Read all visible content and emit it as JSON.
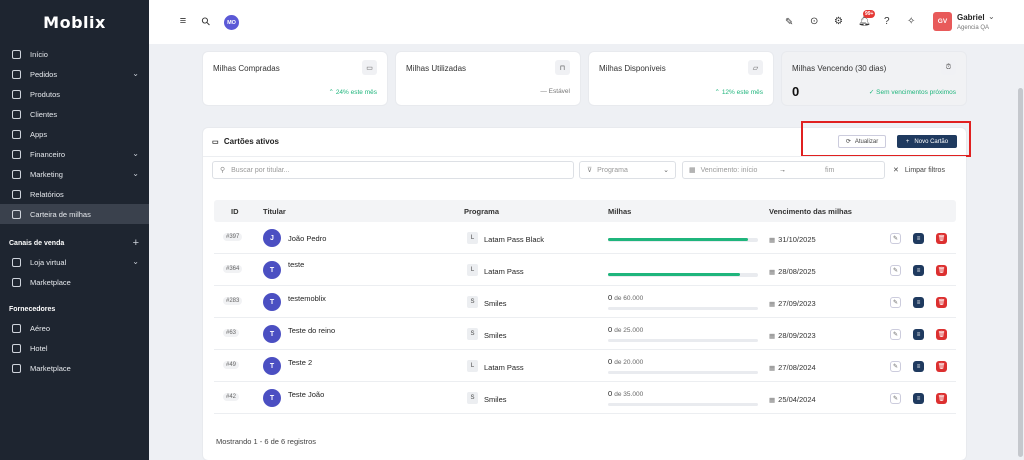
{
  "app": {
    "logo": "Moblix"
  },
  "sidebar": {
    "items": [
      {
        "label": "Início",
        "icon": "home-icon"
      },
      {
        "label": "Pedidos",
        "icon": "document-icon",
        "chevron": true
      },
      {
        "label": "Produtos",
        "icon": "box-icon"
      },
      {
        "label": "Clientes",
        "icon": "users-icon"
      },
      {
        "label": "Apps",
        "icon": "grid-icon"
      },
      {
        "label": "Financeiro",
        "icon": "wallet-icon",
        "chevron": true
      },
      {
        "label": "Marketing",
        "icon": "megaphone-icon",
        "chevron": true
      },
      {
        "label": "Relatórios",
        "icon": "chart-icon"
      },
      {
        "label": "Carteira de milhas",
        "icon": "wallet-icon",
        "active": true
      }
    ],
    "sales_section": {
      "title": "Canais de venda",
      "plus": "+"
    },
    "sales_items": [
      {
        "label": "Loja virtual",
        "icon": "monitor-icon",
        "chevron": true
      },
      {
        "label": "Marketplace",
        "icon": "store-icon"
      }
    ],
    "suppliers_section": {
      "title": "Fornecedores"
    },
    "supplier_items": [
      {
        "label": "Aéreo",
        "icon": "plane-icon"
      },
      {
        "label": "Hotel",
        "icon": "hotel-icon"
      },
      {
        "label": "Marketplace",
        "icon": "store-icon"
      }
    ]
  },
  "topbar": {
    "menu_icon": "≡",
    "search_icon": "⚲",
    "avatar_initials": "MO",
    "notifications_badge": "99+",
    "user": {
      "name": "Gabriel",
      "company": "Agencia QA",
      "initials": "GV"
    }
  },
  "stats": [
    {
      "title": "Milhas Compradas",
      "value": "",
      "trend": "24% este mês",
      "trend_type": "up",
      "icon": "card-icon"
    },
    {
      "title": "Milhas Utilizadas",
      "value": "",
      "trend": "Estável",
      "trend_type": "flat",
      "icon": "bag-icon"
    },
    {
      "title": "Milhas Disponíveis",
      "value": "",
      "trend": "12% este mês",
      "trend_type": "up",
      "icon": "folder-icon"
    },
    {
      "title": "Milhas Vencendo (30 dias)",
      "value": "0",
      "trend": "Sem vencimentos próximos",
      "trend_type": "ok",
      "icon": "alarm-icon"
    }
  ],
  "panel": {
    "title": "Cartões ativos",
    "refresh_label": "Atualizar",
    "new_label": "Novo Cartão",
    "search_placeholder": "Buscar por titular...",
    "program_placeholder": "Programa",
    "date_start_placeholder": "Vencimento: início",
    "date_end_placeholder": "fim",
    "clear_label": "Limpar filtros",
    "columns": [
      "ID",
      "Titular",
      "Programa",
      "Milhas",
      "Vencimento das milhas"
    ],
    "rows": [
      {
        "id": "#397",
        "initial": "J",
        "name": "João Pedro",
        "prog_letter": "L",
        "program": "Latam Pass Black",
        "miles": "",
        "of": "",
        "progress": 0.93,
        "date": "31/10/2025"
      },
      {
        "id": "#364",
        "initial": "T",
        "name": "teste",
        "prog_letter": "L",
        "program": "Latam Pass",
        "miles": "",
        "of": "",
        "progress": 0.88,
        "date": "28/08/2025"
      },
      {
        "id": "#283",
        "initial": "T",
        "name": "testemoblix",
        "prog_letter": "S",
        "program": "Smiles",
        "miles": "0",
        "of": "de 60.000",
        "progress": 0,
        "date": "27/09/2023"
      },
      {
        "id": "#63",
        "initial": "T",
        "name": "Teste do reino",
        "prog_letter": "S",
        "program": "Smiles",
        "miles": "0",
        "of": "de 25.000",
        "progress": 0,
        "date": "28/09/2023"
      },
      {
        "id": "#49",
        "initial": "T",
        "name": "Teste 2",
        "prog_letter": "L",
        "program": "Latam Pass",
        "miles": "0",
        "of": "de 20.000",
        "progress": 0,
        "date": "27/08/2024"
      },
      {
        "id": "#42",
        "initial": "T",
        "name": "Teste João",
        "prog_letter": "S",
        "program": "Smiles",
        "miles": "0",
        "of": "de 35.000",
        "progress": 0,
        "date": "25/04/2024"
      }
    ],
    "footer": "Mostrando 1 - 6 de 6 registros"
  },
  "colors": {
    "accent": "#1f3a5f",
    "sidebar": "#1e2530",
    "success": "#1fb57c",
    "danger": "#dc3030",
    "highlight": "#e02020"
  }
}
